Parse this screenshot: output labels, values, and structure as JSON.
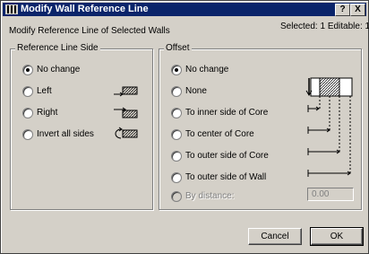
{
  "window": {
    "title": "Modify Wall Reference Line",
    "help_label": "?",
    "close_label": "X"
  },
  "header": {
    "description": "Modify Reference Line of Selected Walls",
    "selection_status": "Selected: 1 Editable: 1"
  },
  "reference_side": {
    "legend": "Reference Line Side",
    "options": [
      {
        "label": "No change",
        "checked": true
      },
      {
        "label": "Left",
        "icon": "wall-left-arrow-icon"
      },
      {
        "label": "Right",
        "icon": "wall-right-arrow-icon"
      },
      {
        "label": "Invert all sides",
        "icon": "wall-invert-arrow-icon"
      }
    ]
  },
  "offset": {
    "legend": "Offset",
    "options": [
      {
        "label": "No change",
        "checked": true
      },
      {
        "label": "None",
        "icon": "wall-section-icon"
      },
      {
        "label": "To inner side of Core"
      },
      {
        "label": "To center of Core"
      },
      {
        "label": "To outer side of Core"
      },
      {
        "label": "To outer side of Wall"
      },
      {
        "label": "By distance:",
        "disabled": true
      }
    ],
    "distance_value": "0.00"
  },
  "buttons": {
    "cancel": "Cancel",
    "ok": "OK"
  }
}
